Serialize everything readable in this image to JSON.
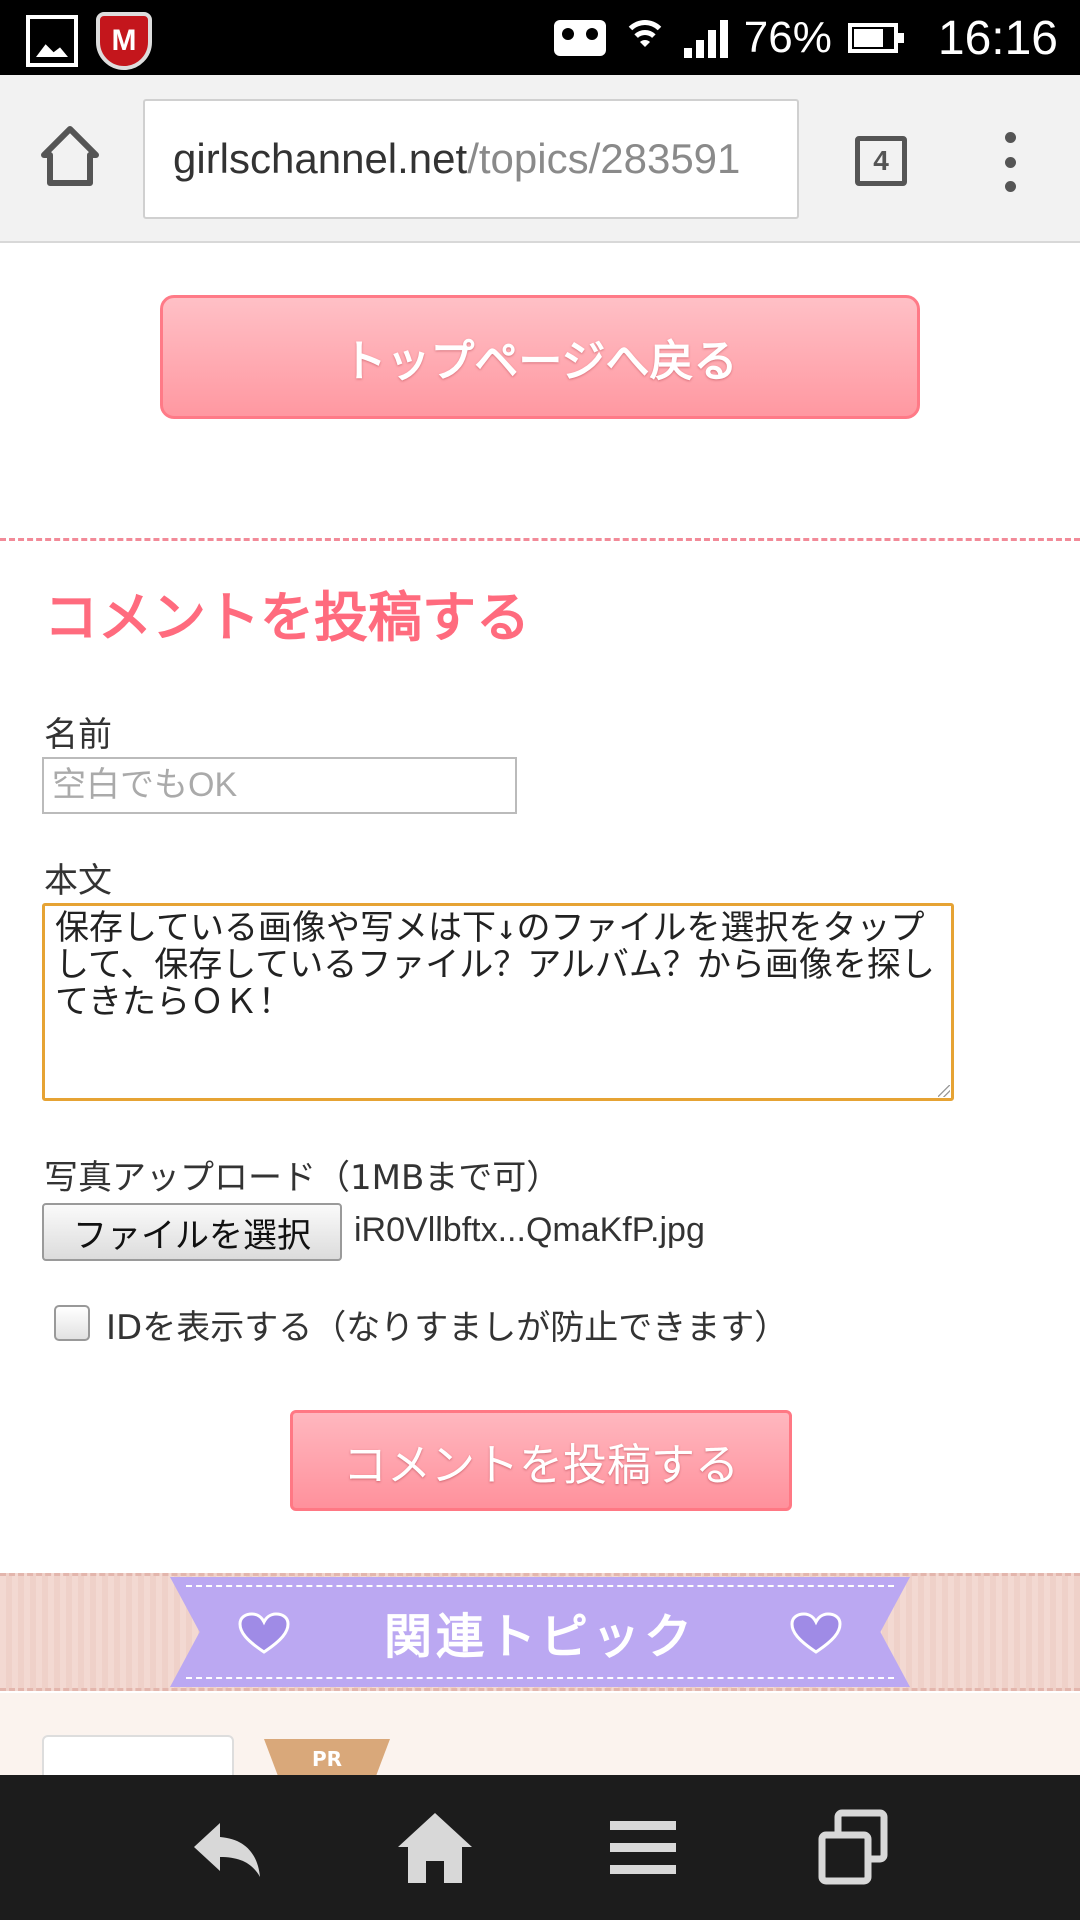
{
  "status_bar": {
    "battery_percent": "76%",
    "time": "16:16",
    "mcafee_letter": "M"
  },
  "browser": {
    "url_host": "girlschannel.net",
    "url_path": "/topics/283591",
    "tab_count": "4"
  },
  "page": {
    "back_to_top_label": "トップページへ戻る",
    "section_title": "コメントを投稿する",
    "name_label": "名前",
    "name_placeholder": "空白でもOK",
    "body_label": "本文",
    "body_value": "保存している画像や写メは下↓のファイルを選択をタップして、保存しているファイル？アルバム？から画像を探してきたらＯＫ！\n",
    "photo_label": "写真アップロード（1MBまで可）",
    "file_button_label": "ファイルを選択",
    "file_name": "iR0Vllbftx...QmaKfP.jpg",
    "show_id_label": "IDを表示する（なりすましが防止できます）",
    "submit_label": "コメントを投稿する",
    "related_topics_title": "関連トピック",
    "pr_label": "PR"
  },
  "colors": {
    "accent_pink": "#ff6b7e",
    "button_pink": "#ff98a1",
    "ribbon_purple": "#bba8f2",
    "textarea_focus": "#e6a334"
  },
  "icons": {
    "status_left": [
      "gallery-icon",
      "mcafee-icon"
    ],
    "status_right": [
      "voicemail-icon",
      "wifi-icon",
      "signal-icon",
      "battery-icon"
    ],
    "toolbar": [
      "home-icon",
      "tab-switcher-icon",
      "overflow-menu-icon"
    ],
    "navbar": [
      "back-icon",
      "home-icon",
      "menu-icon",
      "recent-apps-icon"
    ]
  }
}
